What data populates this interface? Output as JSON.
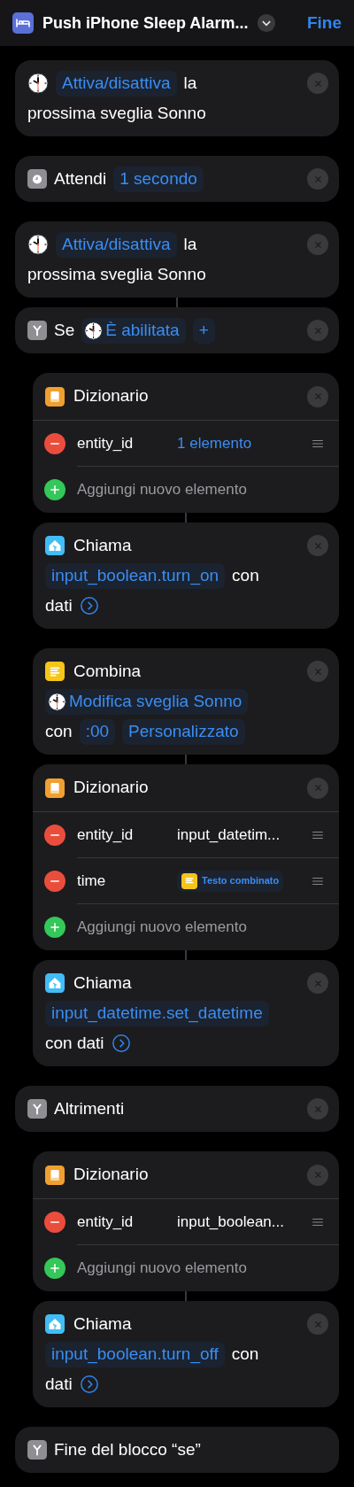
{
  "header": {
    "title": "Push iPhone Sleep Alarm...",
    "done": "Fine"
  },
  "actions": [
    {
      "kind": "toggle",
      "linked": false,
      "removable": true,
      "lines": [
        [
          {
            "kind": "token",
            "text": "Attiva/disattiva"
          },
          {
            "kind": "word",
            "text": "la"
          }
        ],
        [
          {
            "kind": "word",
            "text": "prossima sveglia Sonno"
          }
        ]
      ]
    },
    {
      "kind": "wait",
      "linked": false,
      "removable": true,
      "lines": [
        [
          {
            "kind": "word",
            "text": "Attendi"
          },
          {
            "kind": "token",
            "text": "1 secondo"
          }
        ]
      ]
    },
    {
      "kind": "toggle",
      "linked": false,
      "removable": true,
      "lines": [
        [
          {
            "kind": "token",
            "text": "Attiva/disattiva"
          },
          {
            "kind": "word",
            "text": "la"
          }
        ],
        [
          {
            "kind": "word",
            "text": "prossima sveglia Sonno"
          }
        ]
      ]
    },
    {
      "kind": "if",
      "linked": true,
      "removable": true,
      "lines": [
        [
          {
            "kind": "word",
            "text": "Se"
          },
          {
            "kind": "clock-token",
            "text": "È abilitata"
          },
          {
            "kind": "token",
            "text": "+"
          }
        ]
      ],
      "children": [
        {
          "kind": "dictionary",
          "title": "Dizionario",
          "linked": false,
          "removable": true,
          "rows": [
            {
              "key": "entity_id",
              "value": {
                "kind": "link",
                "text": "1 elemento"
              }
            }
          ],
          "add": "Aggiungi nuovo elemento"
        },
        {
          "kind": "service",
          "title": "Chiama",
          "linked": true,
          "removable": true,
          "lines": [
            [
              {
                "kind": "token",
                "text": "input_boolean.turn_on"
              },
              {
                "kind": "word",
                "text": "con"
              }
            ],
            [
              {
                "kind": "word",
                "text": "dati"
              },
              {
                "kind": "chevron"
              }
            ]
          ]
        },
        {
          "kind": "combine",
          "title": "Combina",
          "linked": false,
          "removable": true,
          "lines": [
            [
              {
                "kind": "clock-token",
                "text": "Modifica sveglia Sonno"
              }
            ],
            [
              {
                "kind": "word",
                "text": "con"
              },
              {
                "kind": "token",
                "text": ":00"
              },
              {
                "kind": "token",
                "text": "Personalizzato"
              }
            ]
          ]
        },
        {
          "kind": "dictionary",
          "title": "Dizionario",
          "linked": true,
          "removable": true,
          "rows": [
            {
              "key": "entity_id",
              "value": {
                "kind": "plain",
                "text": "input_datetim..."
              }
            },
            {
              "key": "time",
              "value": {
                "kind": "text-token",
                "text": "Testo combinato"
              }
            }
          ],
          "add": "Aggiungi nuovo elemento"
        },
        {
          "kind": "service",
          "title": "Chiama",
          "linked": true,
          "removable": true,
          "lines": [
            [
              {
                "kind": "token",
                "text": "input_datetime.set_datetime"
              }
            ],
            [
              {
                "kind": "word",
                "text": "con dati"
              },
              {
                "kind": "chevron"
              }
            ]
          ]
        }
      ]
    },
    {
      "kind": "otherwise",
      "linked": false,
      "removable": true,
      "lines": [
        [
          {
            "kind": "word",
            "text": "Altrimenti"
          }
        ]
      ],
      "children": [
        {
          "kind": "dictionary",
          "title": "Dizionario",
          "linked": false,
          "removable": true,
          "rows": [
            {
              "key": "entity_id",
              "value": {
                "kind": "plain",
                "text": "input_boolean..."
              }
            }
          ],
          "add": "Aggiungi nuovo elemento"
        },
        {
          "kind": "service",
          "title": "Chiama",
          "linked": true,
          "removable": true,
          "lines": [
            [
              {
                "kind": "token",
                "text": "input_boolean.turn_off"
              },
              {
                "kind": "word",
                "text": "con"
              }
            ],
            [
              {
                "kind": "word",
                "text": "dati"
              },
              {
                "kind": "chevron"
              }
            ]
          ]
        }
      ]
    },
    {
      "kind": "end",
      "linked": false,
      "removable": false,
      "lines": [
        [
          {
            "kind": "word",
            "text": "Fine del blocco “se”"
          }
        ]
      ]
    }
  ]
}
